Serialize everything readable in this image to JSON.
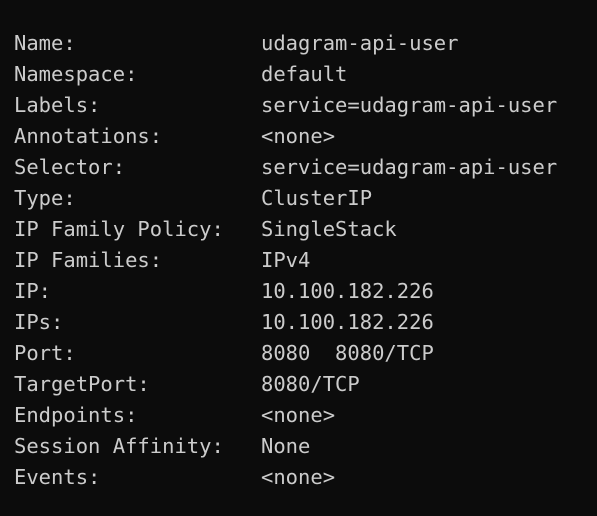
{
  "terminal": {
    "background": "#0c0c0c",
    "foreground": "#cccccc",
    "lines": [
      {
        "key": "Name:",
        "value": "udagram-api-user"
      },
      {
        "key": "Namespace:",
        "value": "default"
      },
      {
        "key": "Labels:",
        "value": "service=udagram-api-user"
      },
      {
        "key": "Annotations:",
        "value": "<none>"
      },
      {
        "key": "Selector:",
        "value": "service=udagram-api-user"
      },
      {
        "key": "Type:",
        "value": "ClusterIP"
      },
      {
        "key": "IP Family Policy:",
        "value": "SingleStack"
      },
      {
        "key": "IP Families:",
        "value": "IPv4"
      },
      {
        "key": "IP:",
        "value": "10.100.182.226"
      },
      {
        "key": "IPs:",
        "value": "10.100.182.226"
      },
      {
        "key": "Port:",
        "value": "8080  8080/TCP"
      },
      {
        "key": "TargetPort:",
        "value": "8080/TCP"
      },
      {
        "key": "Endpoints:",
        "value": "<none>"
      },
      {
        "key": "Session Affinity:",
        "value": "None"
      },
      {
        "key": "Events:",
        "value": "<none>"
      }
    ]
  }
}
